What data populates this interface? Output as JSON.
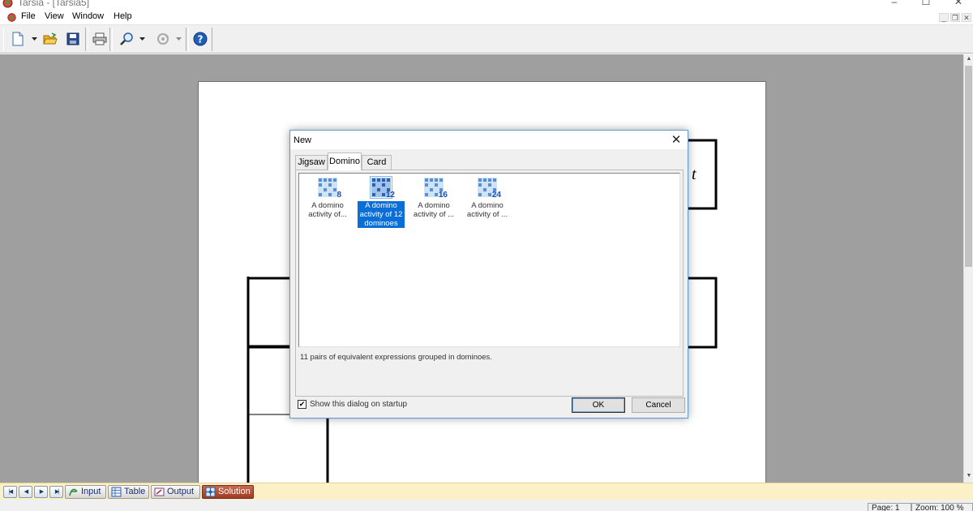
{
  "window": {
    "title": "Tarsia - [Tarsia5]",
    "controls": {
      "minimize": "–",
      "maximize": "☐",
      "close": "✕"
    },
    "mdi_controls": {
      "minimize": "_",
      "restore": "❐",
      "close": "✕"
    }
  },
  "menu": [
    {
      "label": "File"
    },
    {
      "label": "View"
    },
    {
      "label": "Window"
    },
    {
      "label": "Help"
    }
  ],
  "toolbar": {
    "buttons": [
      {
        "name": "new",
        "icon": "new-document-icon"
      },
      {
        "name": "open",
        "icon": "open-folder-icon"
      },
      {
        "name": "save",
        "icon": "floppy-disk-icon"
      },
      {
        "name": "print",
        "icon": "printer-icon"
      },
      {
        "name": "zoom",
        "icon": "magnifier-icon"
      },
      {
        "name": "rotate",
        "icon": "rotate-icon"
      },
      {
        "name": "help",
        "icon": "help-icon"
      }
    ]
  },
  "document": {
    "visible_text": "t"
  },
  "dialog": {
    "title": "New",
    "close_label": "✕",
    "tabs": [
      {
        "label": "Jigsaw",
        "active": false
      },
      {
        "label": "Domino",
        "active": true
      },
      {
        "label": "Card",
        "active": false
      }
    ],
    "items": [
      {
        "number": "8",
        "label": "A domino activity of...",
        "selected": false
      },
      {
        "number": "12",
        "label": "A domino activity of 12 dominoes",
        "selected": true
      },
      {
        "number": "16",
        "label": "A domino activity of ...",
        "selected": false
      },
      {
        "number": "24",
        "label": "A domino activity of ...",
        "selected": false
      }
    ],
    "description": "11 pairs of equivalent expressions grouped in dominoes.",
    "show_on_startup": {
      "label": "Show this dialog on startup",
      "checked": true,
      "mark": "✔"
    },
    "ok_label": "OK",
    "cancel_label": "Cancel"
  },
  "bottom_tabs": [
    {
      "label": "Input",
      "icon": "input-icon",
      "active": false
    },
    {
      "label": "Table",
      "icon": "table-icon",
      "active": false
    },
    {
      "label": "Output",
      "icon": "output-icon",
      "active": false
    },
    {
      "label": "Solution",
      "icon": "solution-icon",
      "active": true
    }
  ],
  "nav_buttons": {
    "first": "|◀",
    "prev": "◀",
    "next": "▶",
    "last": "▶|"
  },
  "status": {
    "page": "Page: 1",
    "zoom": "Zoom: 100 %"
  },
  "colors": {
    "selection": "#0a6ed9",
    "workspace": "#9f9f9f",
    "tabbar": "#fbf0c6",
    "active_tab": "#9e3a22",
    "dialog_border": "#5b9bd5"
  }
}
